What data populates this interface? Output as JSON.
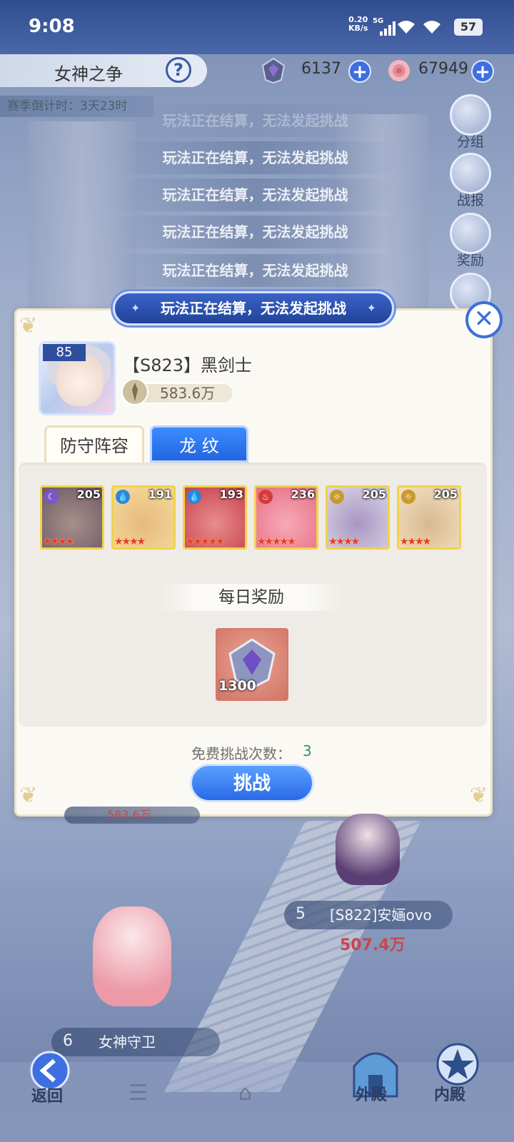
{
  "status_bar": {
    "time": "9:08",
    "net_speed_value": "0.20",
    "net_speed_unit": "KB/s",
    "network": "5G",
    "battery": "57"
  },
  "header": {
    "title": "女神之争",
    "help_symbol": "?",
    "resources": [
      {
        "icon": "crest-icon",
        "value": "6137"
      },
      {
        "icon": "rose-icon",
        "value": "67949"
      }
    ],
    "season_countdown": "赛季倒计时：3天23时"
  },
  "side_menu": [
    {
      "icon": "group-icon",
      "label": "分组"
    },
    {
      "icon": "report-icon",
      "label": "战报"
    },
    {
      "icon": "gift-icon",
      "label": "奖励"
    },
    {
      "icon": "share-icon",
      "label": ""
    }
  ],
  "toasts": [
    "玩法正在结算，无法发起挑战",
    "玩法正在结算，无法发起挑战",
    "玩法正在结算，无法发起挑战",
    "玩法正在结算，无法发起挑战",
    "玩法正在结算，无法发起挑战",
    "玩法正在结算，无法发起挑战"
  ],
  "dialog": {
    "close_symbol": "✕",
    "player": {
      "level": "85",
      "name": "【S823】黑剑士",
      "power": "583.6万"
    },
    "tabs": [
      {
        "label": "防守阵容",
        "active": false
      },
      {
        "label": "龙 纹",
        "active": true
      }
    ],
    "heroes": [
      {
        "level": "205",
        "element": "moon",
        "stars": "★★★★",
        "colors": [
          "#6c5a66",
          "#a88f8a"
        ]
      },
      {
        "level": "191",
        "element": "water",
        "stars": "★★★★",
        "colors": [
          "#f3dc9a",
          "#e8b97f"
        ]
      },
      {
        "level": "193",
        "element": "water",
        "stars": "★★★★★",
        "colors": [
          "#c8414c",
          "#e88d8e"
        ]
      },
      {
        "level": "236",
        "element": "fire",
        "stars": "★★★★★",
        "colors": [
          "#e86e86",
          "#f6aab6"
        ]
      },
      {
        "level": "205",
        "element": "light",
        "stars": "★★★★",
        "colors": [
          "#d8d5e4",
          "#a995c2"
        ]
      },
      {
        "level": "205",
        "element": "light",
        "stars": "★★★★",
        "colors": [
          "#f2e1c2",
          "#d8b98e"
        ]
      }
    ],
    "daily_reward_title": "每日奖励",
    "reward": {
      "icon": "crest-icon",
      "count": "1300"
    },
    "free_challenges_label": "免费挑战次数：",
    "free_challenges_value": "3",
    "challenge_button": "挑战"
  },
  "scene": {
    "partial_power": "583.6万",
    "rank5": {
      "rank": "5",
      "name": "[S822]安婳ovo",
      "power": "507.4万"
    },
    "rank6": {
      "rank": "6",
      "name": "女神守卫"
    }
  },
  "bottom_nav": {
    "back": "返回",
    "outer_hall": "外殿",
    "inner_hall": "内殿"
  }
}
